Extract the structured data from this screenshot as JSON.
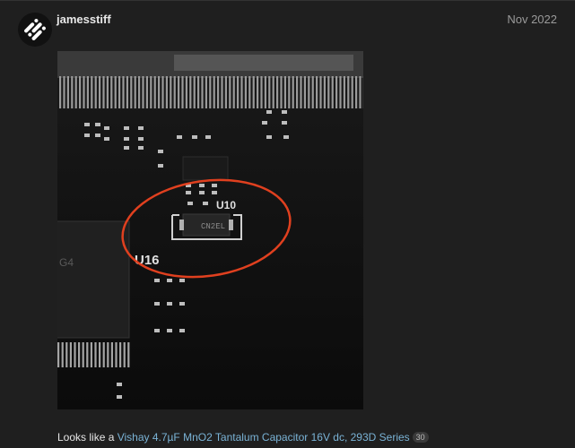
{
  "post": {
    "username": "jamesstiff",
    "date": "Nov 2022",
    "avatar_icon": "discourse-logo-icon"
  },
  "image": {
    "board_labels": {
      "u10": "U10",
      "u16": "U16",
      "chip_marking": "CN2EL",
      "edge_label": "G4"
    },
    "annotation_color": "#e0401f"
  },
  "caption": {
    "prefix": "Looks like a ",
    "link_text": "Vishay 4.7µF MnO2 Tantalum Capacitor 16V dc, 293D Series",
    "click_count": "30"
  }
}
